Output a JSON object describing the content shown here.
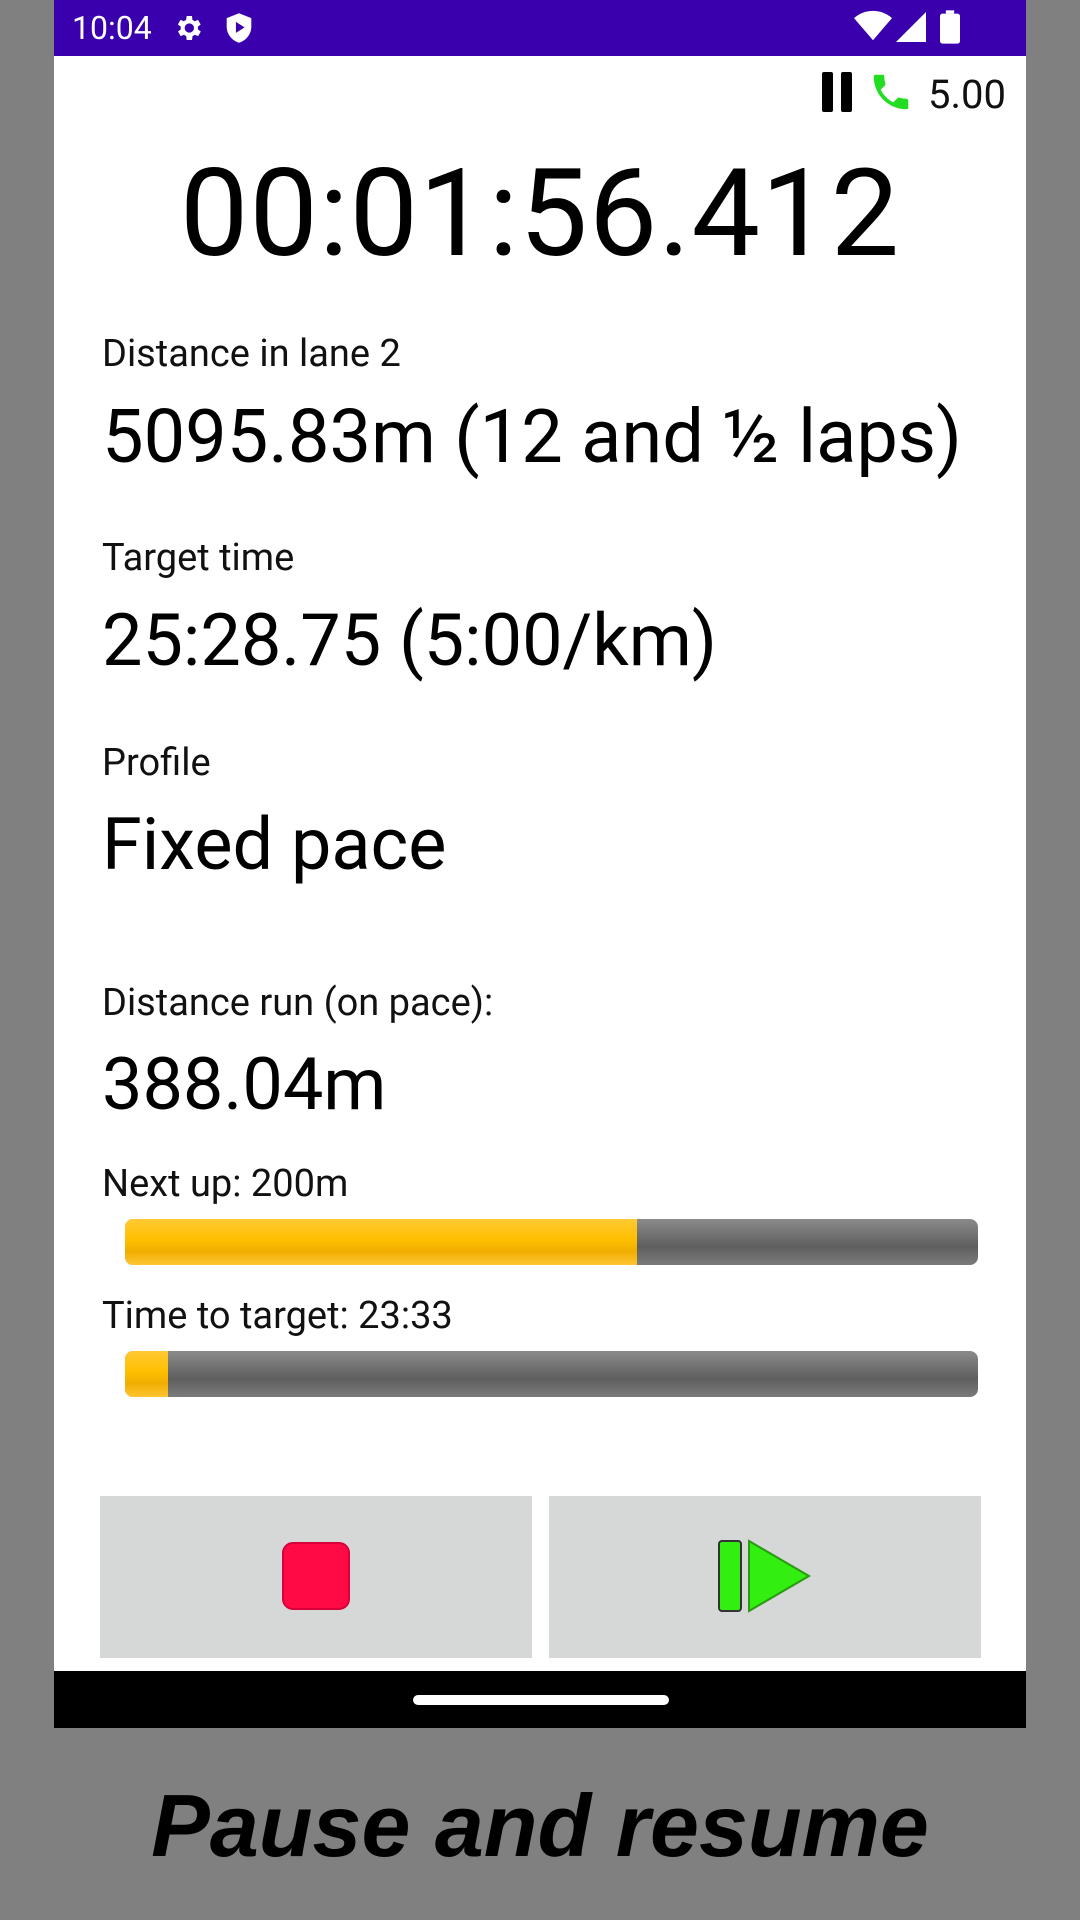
{
  "status_bar": {
    "time": "10:04",
    "icons_left": [
      "gear-icon",
      "shield-play-icon"
    ],
    "icons_right": [
      "wifi-icon",
      "signal-icon",
      "battery-icon"
    ],
    "background_color": "#3b00ad"
  },
  "header": {
    "pause_icon": "pause-icon",
    "phone_icon": "phone-icon",
    "phone_icon_color": "#22dd22",
    "speed_value": "5.00"
  },
  "timer": {
    "elapsed": "00:01:56.412"
  },
  "distance": {
    "label": "Distance in lane 2",
    "value": "5095.83m (12 and ½ laps)"
  },
  "target": {
    "label": "Target time",
    "value": "25:28.75 (5:00/km)"
  },
  "profile": {
    "label": "Profile",
    "value": "Fixed pace"
  },
  "distance_run": {
    "label": "Distance run (on pace):",
    "value": "388.04m"
  },
  "next_up": {
    "label": "Next up: 200m",
    "progress": 0.6
  },
  "time_to_target": {
    "label": "Time to target: 23:33",
    "progress": 0.05
  },
  "buttons": {
    "stop": {
      "icon": "stop-icon",
      "color": "#ff0a45"
    },
    "resume": {
      "icon": "resume-play-icon",
      "color": "#33ee11"
    }
  },
  "caption": "Pause and resume",
  "accent_colors": {
    "progress_fill": "#ffbf00",
    "progress_track": "#6a6a6a"
  }
}
